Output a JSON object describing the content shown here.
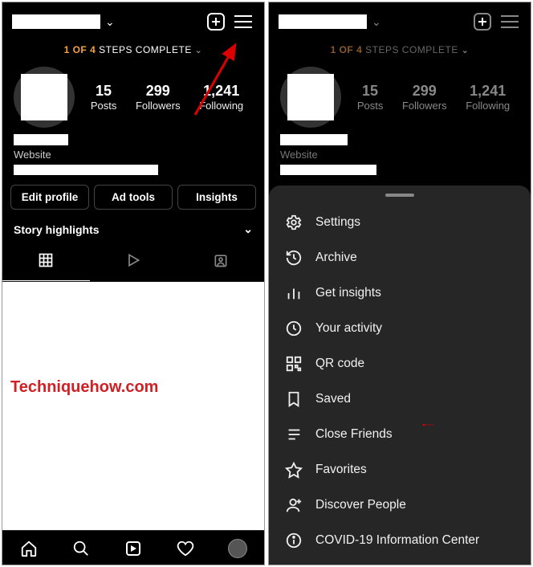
{
  "watermark": "Techniquehow.com",
  "left": {
    "steps": {
      "highlight": "1 OF 4",
      "rest": "STEPS COMPLETE"
    },
    "stats": {
      "posts": {
        "value": "15",
        "label": "Posts"
      },
      "followers": {
        "value": "299",
        "label": "Followers"
      },
      "following": {
        "value": "1,241",
        "label": "Following"
      }
    },
    "bio": {
      "website_label": "Website"
    },
    "buttons": {
      "edit": "Edit profile",
      "ad": "Ad tools",
      "insights": "Insights"
    },
    "story_highlights": "Story highlights"
  },
  "right": {
    "steps": {
      "highlight": "1 OF 4",
      "rest": "STEPS COMPLETE"
    },
    "stats": {
      "posts": {
        "value": "15",
        "label": "Posts"
      },
      "followers": {
        "value": "299",
        "label": "Followers"
      },
      "following": {
        "value": "1,241",
        "label": "Following"
      }
    },
    "bio": {
      "website_label": "Website"
    },
    "menu": {
      "settings": "Settings",
      "archive": "Archive",
      "insights": "Get insights",
      "activity": "Your activity",
      "qr": "QR code",
      "saved": "Saved",
      "close": "Close Friends",
      "favorites": "Favorites",
      "discover": "Discover People",
      "covid": "COVID-19 Information Center"
    }
  }
}
